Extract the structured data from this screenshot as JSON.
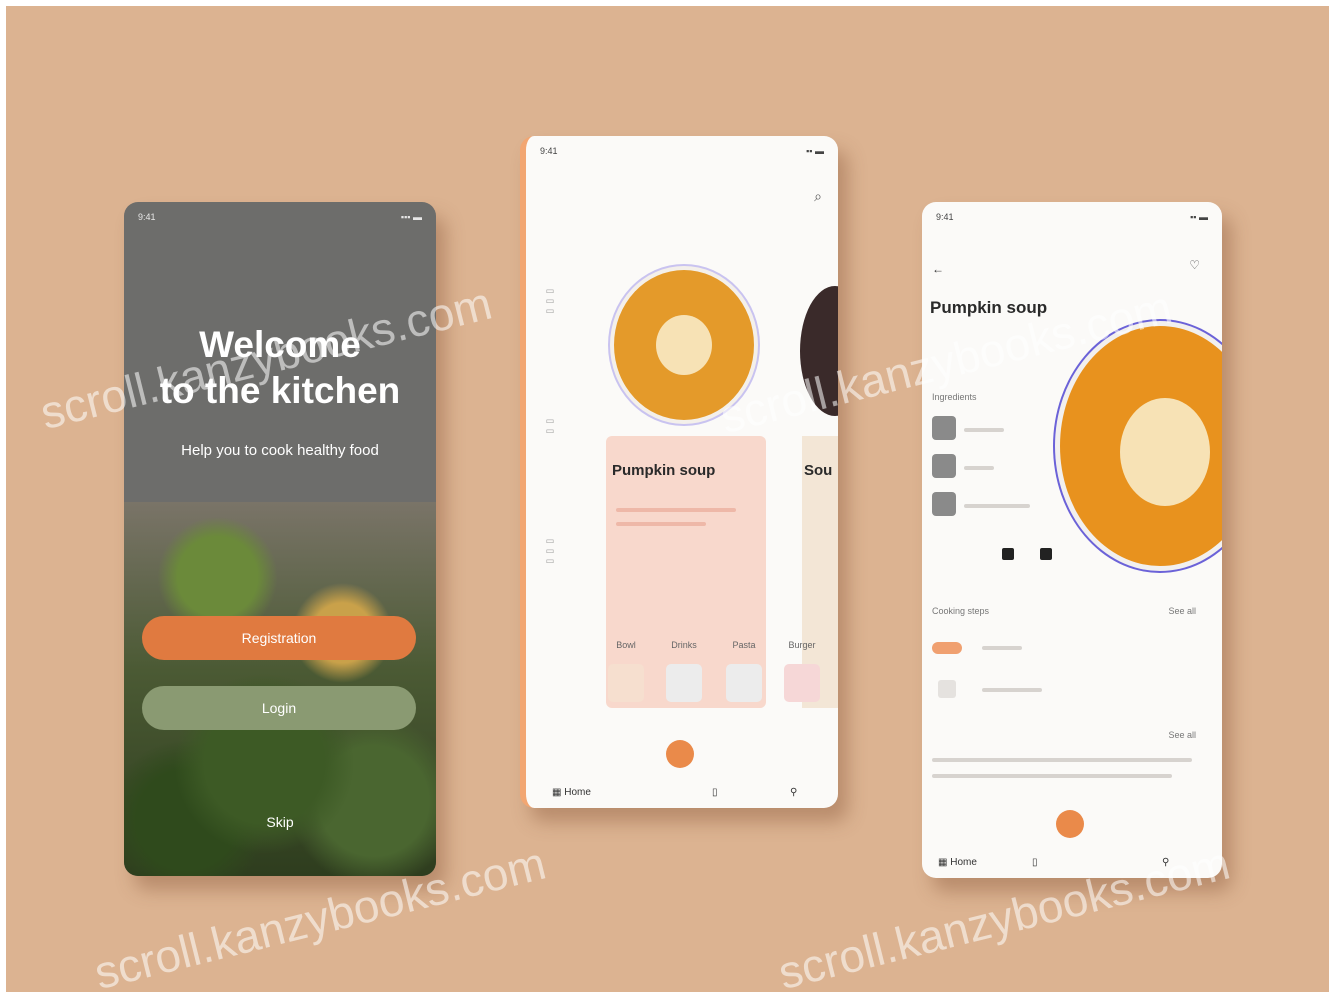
{
  "phone1": {
    "welcome_line1": "Welcome",
    "welcome_line2": "to the kitchen",
    "subtitle": "Help you to cook healthy food",
    "register_button": "Registration",
    "login_button": "Login",
    "skip_link": "Skip"
  },
  "phone2": {
    "recipe_card_1": "Pumpkin soup",
    "recipe_card_2": "Sou",
    "categories": [
      {
        "label": "Bowl"
      },
      {
        "label": "Drinks"
      },
      {
        "label": "Pasta"
      },
      {
        "label": "Burger"
      }
    ],
    "bottom_nav": {
      "home_label": "Home"
    }
  },
  "phone3": {
    "title": "Pumpkin soup",
    "sections": {
      "ingredients": "Ingredients",
      "related_label": "Cooking steps",
      "see_all_1": "See all",
      "see_all_2": "See all"
    },
    "bottom_nav": {
      "home_label": "Home"
    }
  },
  "watermark": "scroll.kanzybooks.com",
  "colors": {
    "background": "#dcb391",
    "accent_orange": "#e07a40",
    "soup": "#e8921e",
    "card_pink": "#f8d8cc",
    "plate_ring": "#6b62d8"
  }
}
